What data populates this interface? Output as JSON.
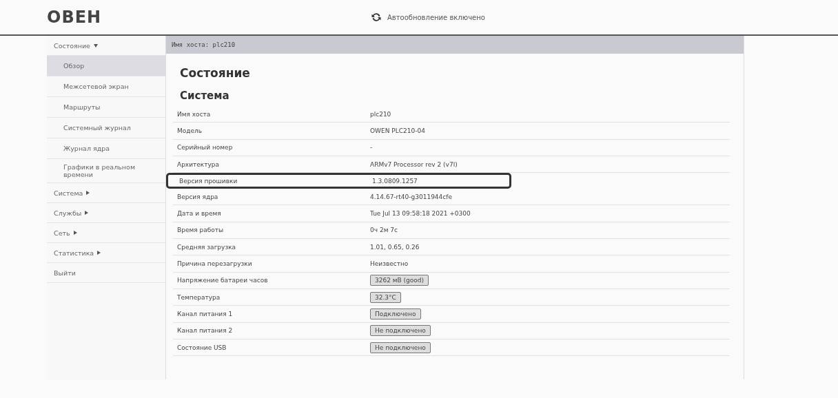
{
  "header": {
    "logo": "ОВЕН",
    "autorefresh": {
      "label": "Автообновление включено",
      "on": true
    }
  },
  "sidebar": {
    "items": [
      {
        "label": "Состояние",
        "expanded": true,
        "children": [
          {
            "label": "Обзор",
            "selected": true
          },
          {
            "label": "Межсетевой экран",
            "selected": false
          },
          {
            "label": "Маршруты",
            "selected": false
          },
          {
            "label": "Системный журнал",
            "selected": false
          },
          {
            "label": "Журнал ядра",
            "selected": false
          },
          {
            "label": "Графики в реальном времени",
            "selected": false
          }
        ]
      },
      {
        "label": "Система",
        "expanded": false
      },
      {
        "label": "Службы",
        "expanded": false
      },
      {
        "label": "Сеть",
        "expanded": false
      },
      {
        "label": "Статистика",
        "expanded": false
      },
      {
        "label": "Выйти",
        "kind": "link"
      }
    ]
  },
  "breadcrumb": "Имя хоста: plc210",
  "page_title": "Состояние",
  "section_title": "Система",
  "table": {
    "rows": [
      {
        "label": "Имя хоста",
        "value": "plc210",
        "kind": "text",
        "highlighted": false
      },
      {
        "label": "Модель",
        "value": "OWEN PLC210-04",
        "kind": "text",
        "highlighted": false
      },
      {
        "label": "Серийный номер",
        "value": "-",
        "kind": "text",
        "highlighted": false
      },
      {
        "label": "Архитектура",
        "value": "ARMv7 Processor rev 2 (v7l)",
        "kind": "text",
        "highlighted": false
      },
      {
        "label": "Версия прошивки",
        "value": "1.3.0809.1257",
        "kind": "text",
        "highlighted": true
      },
      {
        "label": "Версия ядра",
        "value": "4.14.67-rt40-g3011944cfe",
        "kind": "text",
        "highlighted": false
      },
      {
        "label": "Дата и время",
        "value": "Tue Jul 13 09:58:18 2021 +0300",
        "kind": "text",
        "highlighted": false
      },
      {
        "label": "Время работы",
        "value": "0ч 2м 7с",
        "kind": "text",
        "highlighted": false
      },
      {
        "label": "Средняя загрузка",
        "value": "1.01, 0.65, 0.26",
        "kind": "text",
        "highlighted": false
      },
      {
        "label": "Причина перезагрузки",
        "value": "Неизвестно",
        "kind": "text",
        "highlighted": false
      },
      {
        "label": "Напряжение батареи часов",
        "value": "3262 мВ (good)",
        "kind": "badge",
        "highlighted": false
      },
      {
        "label": "Температура",
        "value": "32.3°C",
        "kind": "badge",
        "highlighted": false
      },
      {
        "label": "Канал питания 1",
        "value": "Подключено",
        "kind": "badge",
        "highlighted": false
      },
      {
        "label": "Канал питания 2",
        "value": "Не подключено",
        "kind": "badge",
        "highlighted": false
      },
      {
        "label": "Состояние USB",
        "value": "Не подключено",
        "kind": "badge",
        "highlighted": false
      }
    ]
  }
}
